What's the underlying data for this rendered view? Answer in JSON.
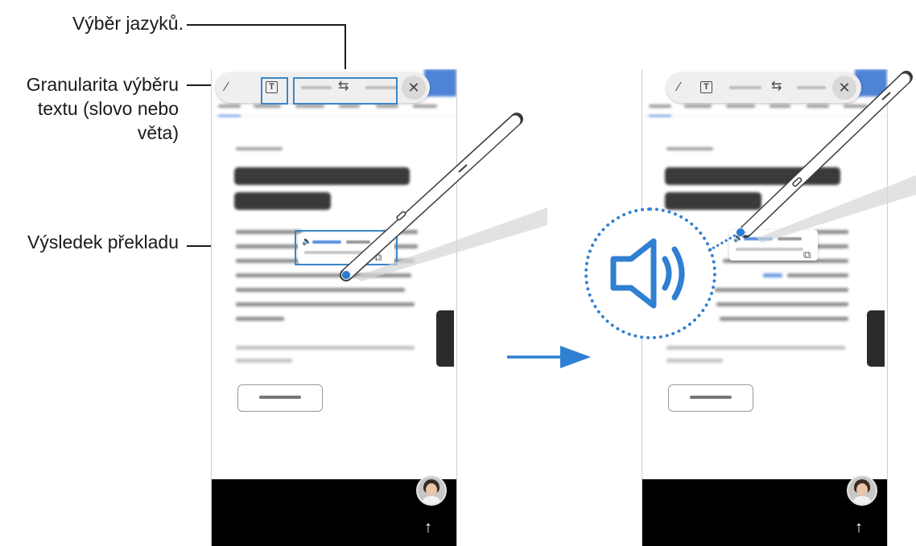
{
  "callouts": {
    "language_selection": "Výběr jazyků.",
    "granularity_line1": "Granularita výběru",
    "granularity_line2": "textu (slovo nebo",
    "granularity_line3": "věta)",
    "translation_result": "Výsledek překladu"
  },
  "icons": {
    "translate_tool": "pen-cursor-icon",
    "text_mode": "text-granularity-icon",
    "swap": "swap-languages-icon",
    "close": "close-icon",
    "speaker": "speaker-icon",
    "copy": "copy-icon",
    "scroll_top": "arrow-up-icon",
    "flow": "arrow-right-icon"
  },
  "glyphs": {
    "pen": "⁄",
    "text_mode": "T",
    "swap": "⇆",
    "close": "✕",
    "speaker": "🔈",
    "copy": "⧉",
    "scroll_top": "↑"
  },
  "colors": {
    "accent": "#2f7fd2",
    "highlight_box": "#3a86c8",
    "toolbar_bg": "#efefef",
    "video_bg": "#000000"
  }
}
